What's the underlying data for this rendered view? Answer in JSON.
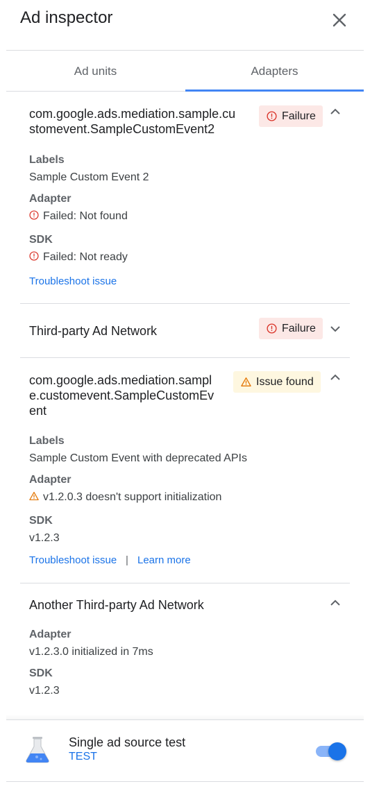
{
  "header": {
    "title": "Ad inspector"
  },
  "tabs": [
    {
      "label": "Ad units"
    },
    {
      "label": "Adapters",
      "selected": true
    }
  ],
  "colors": {
    "accent": "#1a73e8",
    "failure": "#d93025",
    "warning": "#e37400",
    "tab_indicator": "#4285f4"
  },
  "adapters": [
    {
      "name": "com.google.ads.mediation.sample.customevent.SampleCustomEvent2",
      "name_lines": [
        "com.google.ads.mediation.sample.cu",
        "stomevent.SampleCustomEvent2"
      ],
      "status": "Failure",
      "expanded": true,
      "labels_heading": "Labels",
      "labels_value": "Sample Custom Event 2",
      "adapter_heading": "Adapter",
      "adapter_value": "Failed: Not found",
      "sdk_heading": "SDK",
      "sdk_value": "Failed: Not ready",
      "link": "Troubleshoot issue"
    },
    {
      "name": "Third-party Ad Network",
      "status": "Failure",
      "expanded": false
    },
    {
      "name": "com.google.ads.mediation.sample.customevent.SampleCustomEvent",
      "name_lines": [
        "com.google.ads.mediation.sampl",
        "e.customevent.SampleCustomEv",
        "ent"
      ],
      "status": "Issue found",
      "expanded": true,
      "labels_heading": "Labels",
      "labels_value": "Sample Custom Event with deprecated APIs",
      "adapter_heading": "Adapter",
      "adapter_value": "v1.2.0.3 doesn't support initialization",
      "sdk_heading": "SDK",
      "sdk_value": "v1.2.3",
      "link": "Troubleshoot issue",
      "separator": "|",
      "link2": "Learn more"
    },
    {
      "name": "Another Third-party Ad Network",
      "expanded": true,
      "adapter_heading": "Adapter",
      "adapter_value": "v1.2.3.0 initialized in 7ms",
      "sdk_heading": "SDK",
      "sdk_value": "v1.2.3"
    }
  ],
  "footer": {
    "title": "Single ad source test",
    "subtitle": "TEST",
    "toggle_on": true
  }
}
